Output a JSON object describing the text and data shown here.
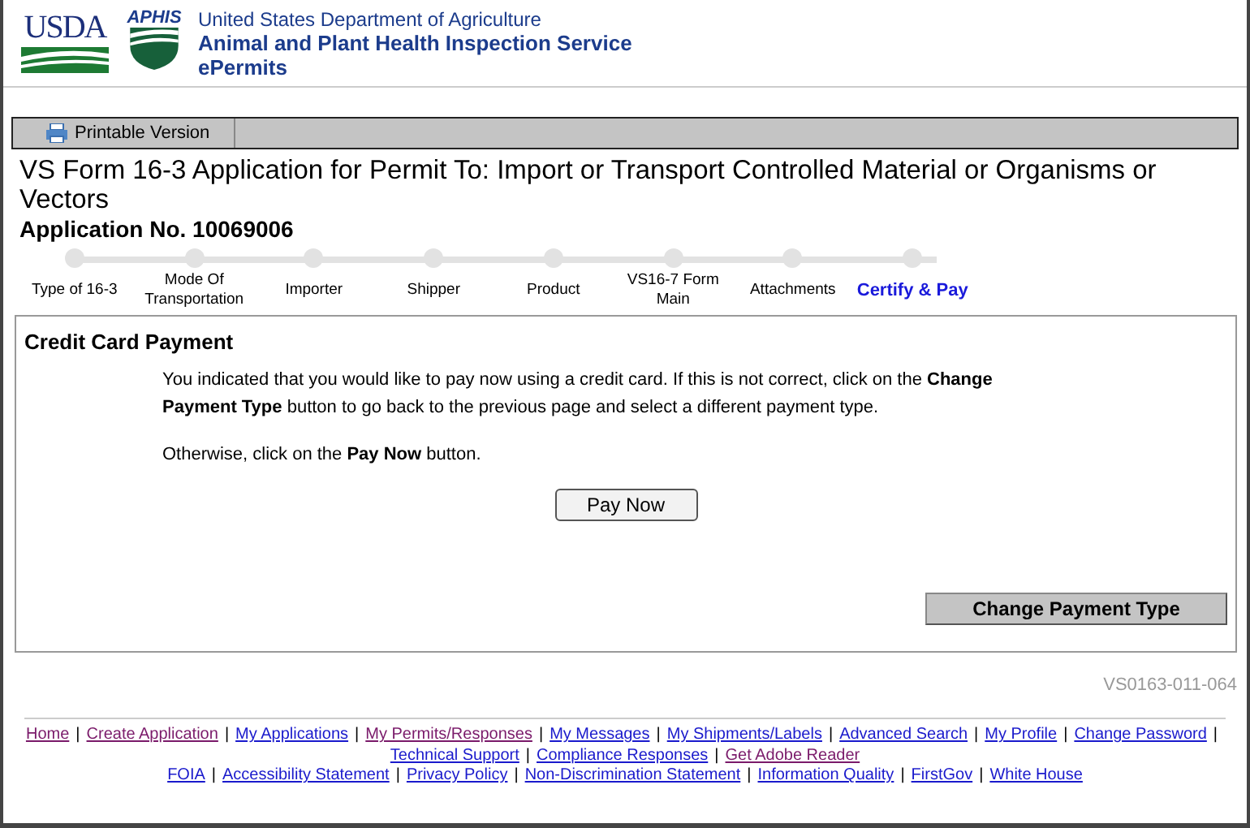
{
  "header": {
    "usda": "USDA",
    "aphis": "APHIS",
    "department": "United States Department of Agriculture",
    "agency": "Animal and Plant Health Inspection Service",
    "app": "ePermits"
  },
  "toolbar": {
    "printable": "Printable Version"
  },
  "title": "VS Form 16-3 Application for Permit To: Import or Transport Controlled Material or Organisms or Vectors",
  "application_no": "Application No. 10069006",
  "steps": [
    {
      "label": "Type of 16-3",
      "selected": false
    },
    {
      "label": "Mode Of\nTransportation",
      "selected": false
    },
    {
      "label": "Importer",
      "selected": false
    },
    {
      "label": "Shipper",
      "selected": false
    },
    {
      "label": "Product",
      "selected": false
    },
    {
      "label": "VS16-7 Form\nMain",
      "selected": false
    },
    {
      "label": "Attachments",
      "selected": false
    },
    {
      "label": "Certify & Pay",
      "selected": true
    }
  ],
  "panel": {
    "title": "Credit Card Payment",
    "paragraphs": [
      "You indicated that you would like to pay now using a credit card.  If this is not correct, click on the **Change Payment Type** button to go back to the previous page and select a different payment type.",
      "Otherwise, click on the **Pay Now** button."
    ],
    "pay_button": "Pay Now",
    "change_button": "Change Payment Type"
  },
  "form_code": "VS0163-011-064",
  "footer_lines": [
    [
      {
        "label": "Home",
        "visited": true
      },
      {
        "label": "Create Application",
        "visited": true
      },
      {
        "label": "My Applications",
        "visited": false
      },
      {
        "label": "My Permits/Responses",
        "visited": true
      },
      {
        "label": "My Messages",
        "visited": false
      },
      {
        "label": "My Shipments/Labels",
        "visited": false
      },
      {
        "label": "Advanced Search",
        "visited": false
      },
      {
        "label": "My Profile",
        "visited": false
      },
      {
        "label": "Change Password",
        "visited": false
      },
      {
        "label": "Technical Support",
        "visited": false
      },
      {
        "label": "Compliance Responses",
        "visited": false
      },
      {
        "label": "Get Adobe Reader",
        "visited": true
      }
    ],
    [
      {
        "label": "FOIA",
        "visited": false
      },
      {
        "label": "Accessibility Statement",
        "visited": false
      },
      {
        "label": "Privacy Policy",
        "visited": false
      },
      {
        "label": "Non-Discrimination Statement",
        "visited": false
      },
      {
        "label": "Information Quality ",
        "visited": false
      },
      {
        "label": "FirstGov",
        "visited": false
      },
      {
        "label": "White House",
        "visited": false
      }
    ]
  ],
  "separator": "|"
}
